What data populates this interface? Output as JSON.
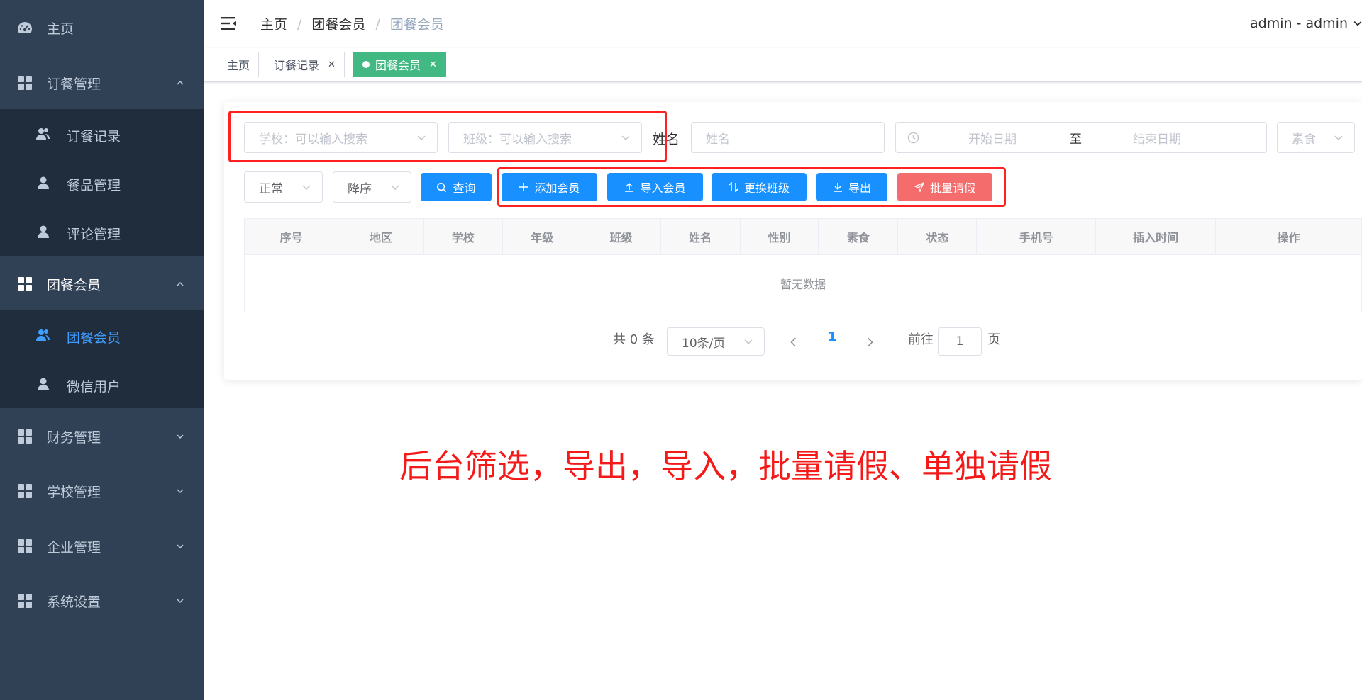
{
  "sidebar": {
    "items": [
      {
        "label": "主页",
        "icon": "dashboard-icon"
      },
      {
        "label": "订餐管理",
        "icon": "grid-icon",
        "expanded": true,
        "children": [
          {
            "label": "订餐记录",
            "icon": "peoples-icon"
          },
          {
            "label": "餐品管理",
            "icon": "user-icon"
          },
          {
            "label": "评论管理",
            "icon": "user-icon"
          }
        ]
      },
      {
        "label": "团餐会员",
        "icon": "grid-icon",
        "expanded": true,
        "children": [
          {
            "label": "团餐会员",
            "icon": "peoples-icon",
            "active": true
          },
          {
            "label": "微信用户",
            "icon": "user-icon"
          }
        ]
      },
      {
        "label": "财务管理",
        "icon": "grid-icon"
      },
      {
        "label": "学校管理",
        "icon": "grid-icon"
      },
      {
        "label": "企业管理",
        "icon": "grid-icon"
      },
      {
        "label": "系统设置",
        "icon": "grid-icon"
      }
    ]
  },
  "header": {
    "breadcrumb": [
      "主页",
      "团餐会员",
      "团餐会员"
    ],
    "user": "admin - admin"
  },
  "tags": [
    {
      "label": "主页",
      "closable": false,
      "active": false
    },
    {
      "label": "订餐记录",
      "closable": true,
      "active": false
    },
    {
      "label": "团餐会员",
      "closable": true,
      "active": true
    }
  ],
  "filters": {
    "school_placeholder": "学校：可以输入搜索",
    "class_placeholder": "班级：可以输入搜索",
    "name_label": "姓名",
    "name_placeholder": "姓名",
    "start_date_placeholder": "开始日期",
    "date_separator": "至",
    "end_date_placeholder": "结束日期",
    "vegetarian_placeholder": "素食",
    "status_value": "正常",
    "order_value": "降序"
  },
  "buttons": {
    "search": "查询",
    "add": "添加会员",
    "import": "导入会员",
    "change_class": "更换班级",
    "export": "导出",
    "batch_leave": "批量请假"
  },
  "table": {
    "columns": [
      "序号",
      "地区",
      "学校",
      "年级",
      "班级",
      "姓名",
      "性别",
      "素食",
      "状态",
      "手机号",
      "插入时间",
      "操作"
    ],
    "empty_text": "暂无数据"
  },
  "pagination": {
    "total_text": "共 0 条",
    "page_size": "10条/页",
    "current_page": "1",
    "goto_label": "前往",
    "goto_value": "1",
    "page_suffix": "页"
  },
  "annotation": {
    "caption": "后台筛选，导出，导入，批量请假、单独请假"
  },
  "colors": {
    "sidebar_bg": "#304156",
    "submenu_bg": "#1f2d3d",
    "primary": "#1890ff",
    "danger": "#f56c6c",
    "active_tag": "#42b983",
    "annotation": "#ff2020"
  }
}
